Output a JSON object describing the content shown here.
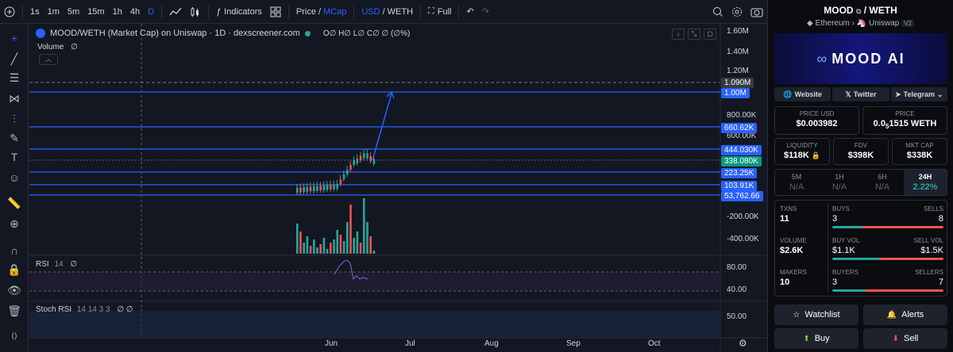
{
  "toolbar": {
    "timeframes": [
      "1s",
      "1m",
      "5m",
      "15m",
      "1h",
      "4h",
      "D"
    ],
    "active_timeframe": "D",
    "indicators_label": "Indicators",
    "price_label": "Price",
    "slash": "/",
    "mcap_label": "MCap",
    "usd_label": "USD",
    "weth_label": "WETH",
    "full_label": "Full"
  },
  "chart": {
    "title": "MOOD/WETH (Market Cap) on Uniswap · 1D · dexscreener.com",
    "ohlc": "O∅ H∅ L∅ C∅ ∅ (∅%)",
    "volume_label": "Volume",
    "volume_value": "∅",
    "rsi_label": "RSI",
    "rsi_params": "14",
    "rsi_value": "∅",
    "stoch_label": "Stoch RSI",
    "stoch_params": "14 14 3 3",
    "stoch_values": "∅ ∅",
    "price_axis": [
      "1.60M",
      "1.40M",
      "1.20M",
      "800.00K",
      "600.00K",
      "-200.00K",
      "-400.00K"
    ],
    "rsi_axis": [
      "80.00",
      "40.00"
    ],
    "stoch_axis": [
      "50.00"
    ],
    "time_axis": [
      "Jun",
      "Jul",
      "Aug",
      "Sep",
      "Oct"
    ],
    "price_tags": [
      {
        "label": "1.090M",
        "color": "#363a45"
      },
      {
        "label": "1.00M",
        "color": "#2962ff"
      },
      {
        "label": "660.62K",
        "color": "#2962ff"
      },
      {
        "label": "444.030K",
        "color": "#2962ff"
      },
      {
        "label": "338.080K",
        "color": "#089981"
      },
      {
        "label": "223.25K",
        "color": "#2962ff"
      },
      {
        "label": "103.91K",
        "color": "#2962ff"
      },
      {
        "label": "53,762.66",
        "color": "#2962ff"
      }
    ],
    "colors": {
      "up": "#26a69a",
      "down": "#ef5350",
      "line": "#2962ff",
      "rsi": "#7e57c2"
    }
  },
  "panel": {
    "pair_base": "MOOD",
    "pair_quote": "/ WETH",
    "chain": "Ethereum",
    "dex": "Uniswap",
    "version": "V2",
    "banner_text": "MOOD AI",
    "links": [
      "Website",
      "Twitter",
      "Telegram"
    ],
    "price_usd_label": "PRICE USD",
    "price_usd": "$0.003982",
    "price_label": "PRICE",
    "price_weth_pre": "0.0",
    "price_weth_sub": "5",
    "price_weth_post": "1515 WETH",
    "liquidity_label": "LIQUIDITY",
    "liquidity": "$118K",
    "fdv_label": "FDV",
    "fdv": "$398K",
    "mktcap_label": "MKT CAP",
    "mktcap": "$338K",
    "timeframes": [
      {
        "label": "5M",
        "value": "N/A"
      },
      {
        "label": "1H",
        "value": "N/A"
      },
      {
        "label": "6H",
        "value": "N/A"
      },
      {
        "label": "24H",
        "value": "2.22%"
      }
    ],
    "txns_label": "TXNS",
    "txns": "11",
    "buys_label": "BUYS",
    "buys": "3",
    "sells_label": "SELLS",
    "sells": "8",
    "buys_ratio": 0.27,
    "volume_label": "VOLUME",
    "volume": "$2.6K",
    "buy_vol_label": "BUY VOL",
    "buy_vol": "$1.1K",
    "sell_vol_label": "SELL VOL",
    "sell_vol": "$1.5K",
    "vol_ratio": 0.42,
    "makers_label": "MAKERS",
    "makers": "10",
    "buyers_label": "BUYERS",
    "buyers": "3",
    "sellers_label": "SELLERS",
    "sellers": "7",
    "buyers_ratio": 0.3,
    "watchlist": "Watchlist",
    "alerts": "Alerts",
    "buy": "Buy",
    "sell": "Sell"
  }
}
